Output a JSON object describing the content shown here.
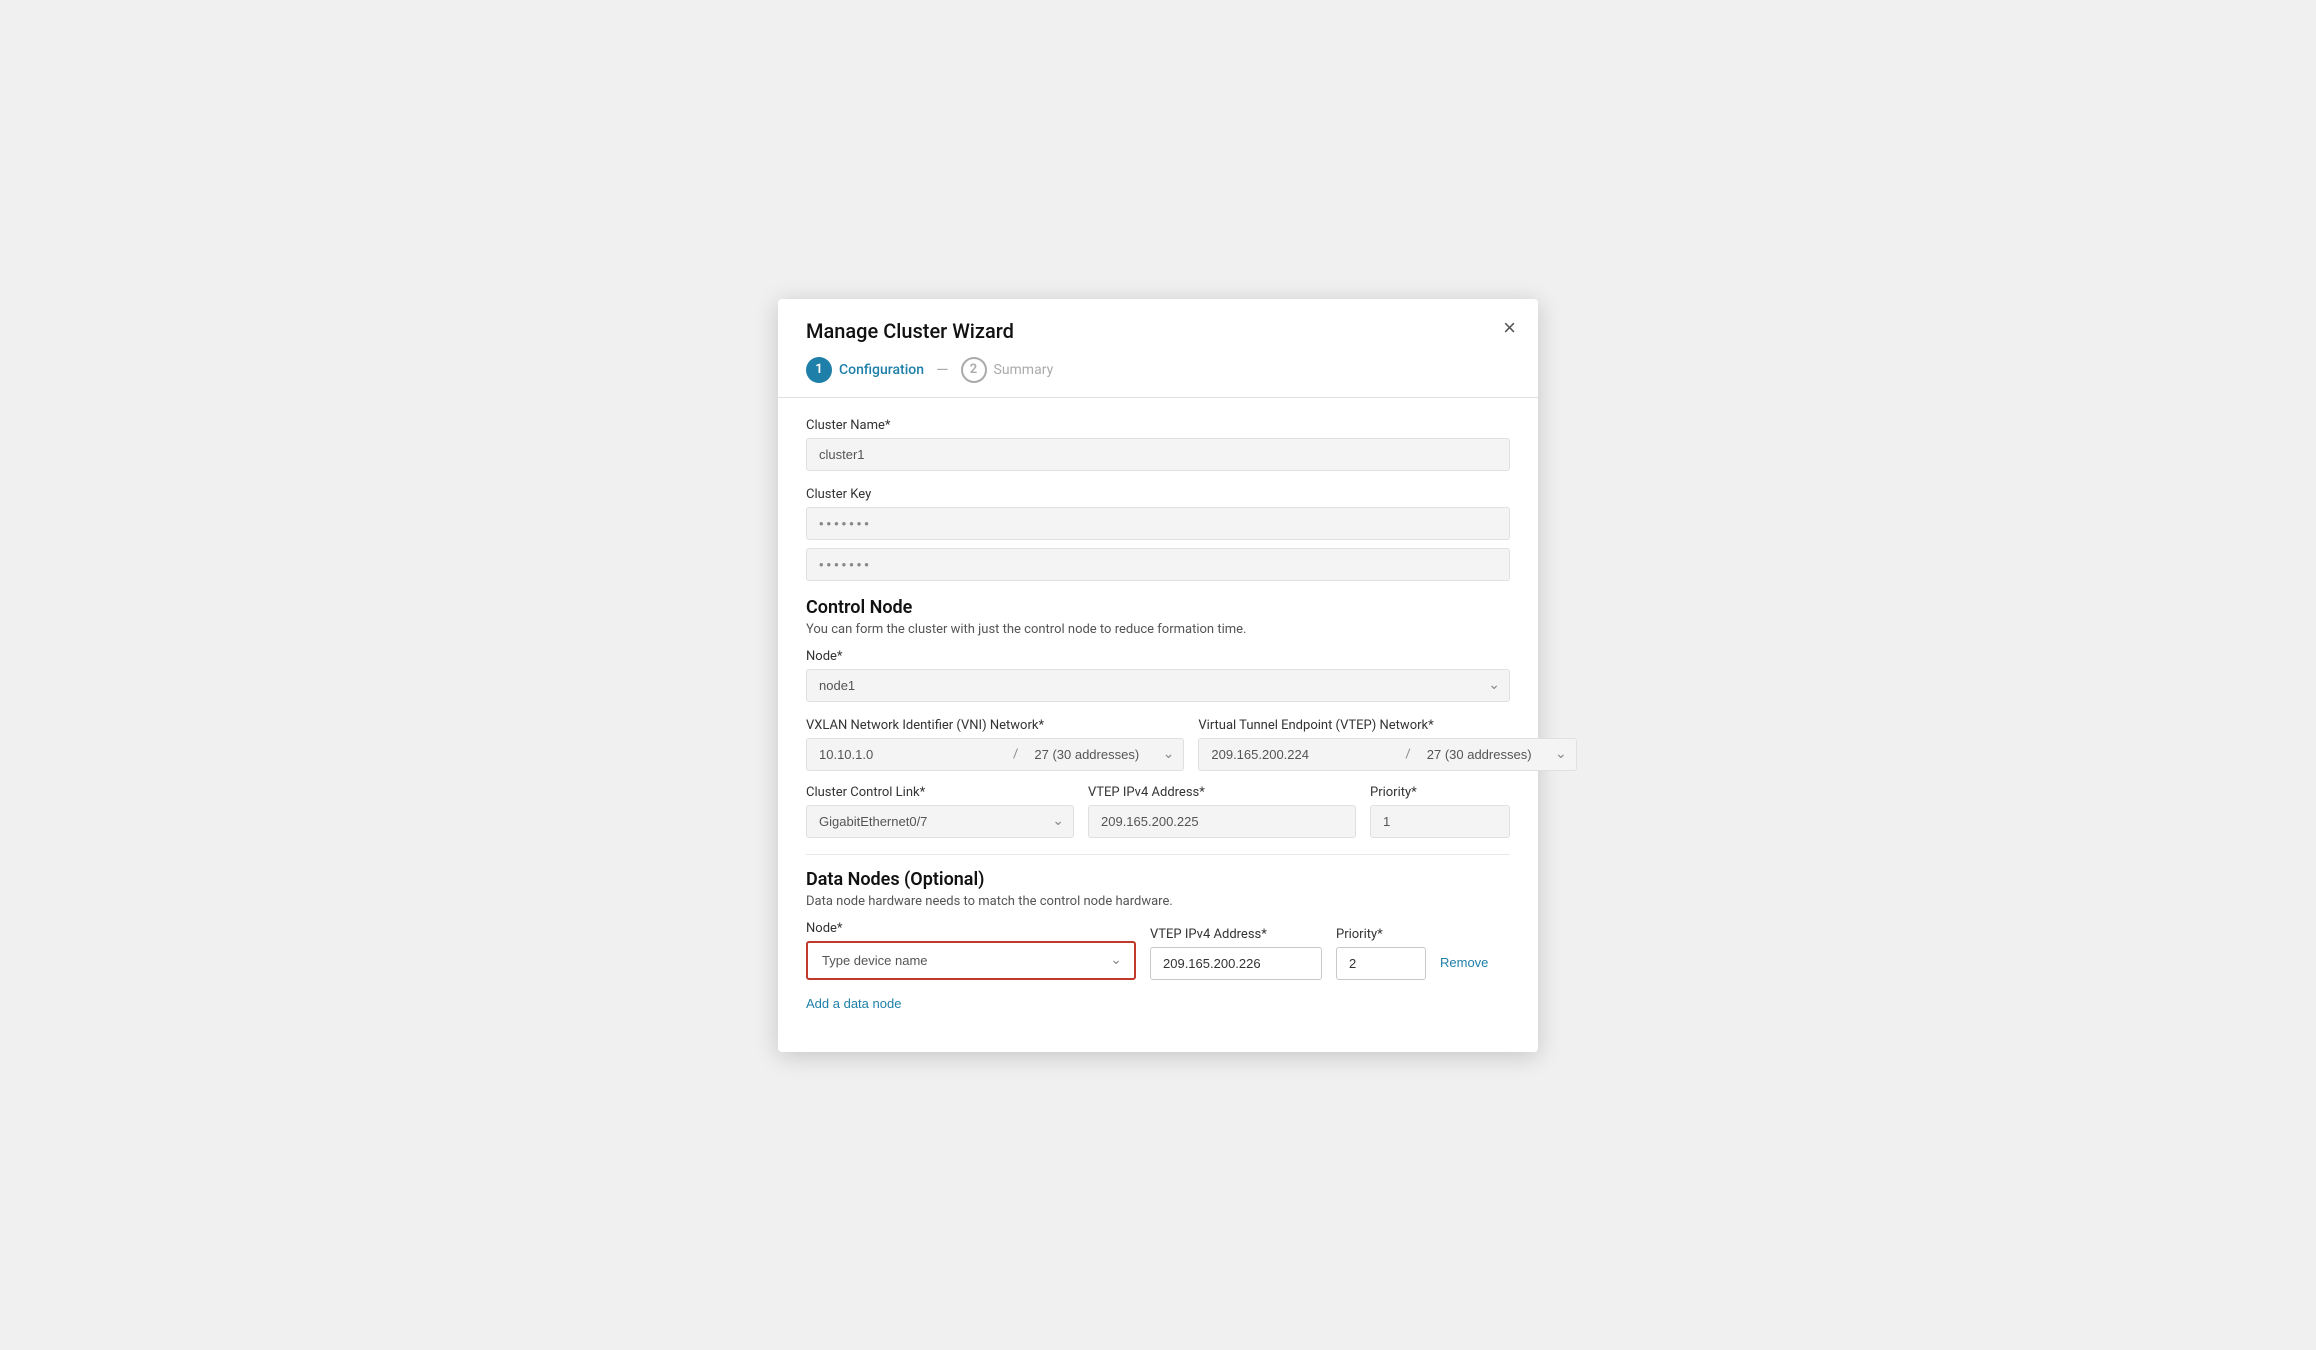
{
  "dialog": {
    "title": "Manage Cluster Wizard",
    "close_label": "×"
  },
  "wizard": {
    "step1": {
      "number": "1",
      "label": "Configuration"
    },
    "divider": "—",
    "step2": {
      "number": "2",
      "label": "Summary"
    }
  },
  "form": {
    "cluster_name_label": "Cluster Name*",
    "cluster_name_value": "cluster1",
    "cluster_key_label": "Cluster Key",
    "cluster_key_value1": "·······",
    "cluster_key_value2": "·······",
    "control_node_title": "Control Node",
    "control_node_subtitle": "You can form the cluster with just the control node to reduce formation time.",
    "node_label": "Node*",
    "node_value": "node1",
    "vni_network_label": "VXLAN Network Identifier (VNI) Network*",
    "vni_ip": "10.10.1.0",
    "vni_slash": "/",
    "vni_cidr": "27 (30 addresses)",
    "vtep_network_label": "Virtual Tunnel Endpoint (VTEP) Network*",
    "vtep_ip": "209.165.200.224",
    "vtep_slash": "/",
    "vtep_cidr": "27 (30 addresses)",
    "cluster_control_link_label": "Cluster Control Link*",
    "cluster_control_link_value": "GigabitEthernet0/7",
    "vtep_ipv4_label": "VTEP IPv4 Address*",
    "vtep_ipv4_value": "209.165.200.225",
    "priority_label": "Priority*",
    "priority_value": "1",
    "data_nodes_title": "Data Nodes (Optional)",
    "data_nodes_subtitle": "Data node hardware needs to match the control node hardware.",
    "data_node_label": "Node*",
    "data_node_placeholder": "Type device name",
    "data_node_vtep_label": "VTEP IPv4 Address*",
    "data_node_vtep_value": "209.165.200.226",
    "data_node_priority_label": "Priority*",
    "data_node_priority_value": "2",
    "remove_label": "Remove",
    "add_node_label": "Add a data node"
  }
}
